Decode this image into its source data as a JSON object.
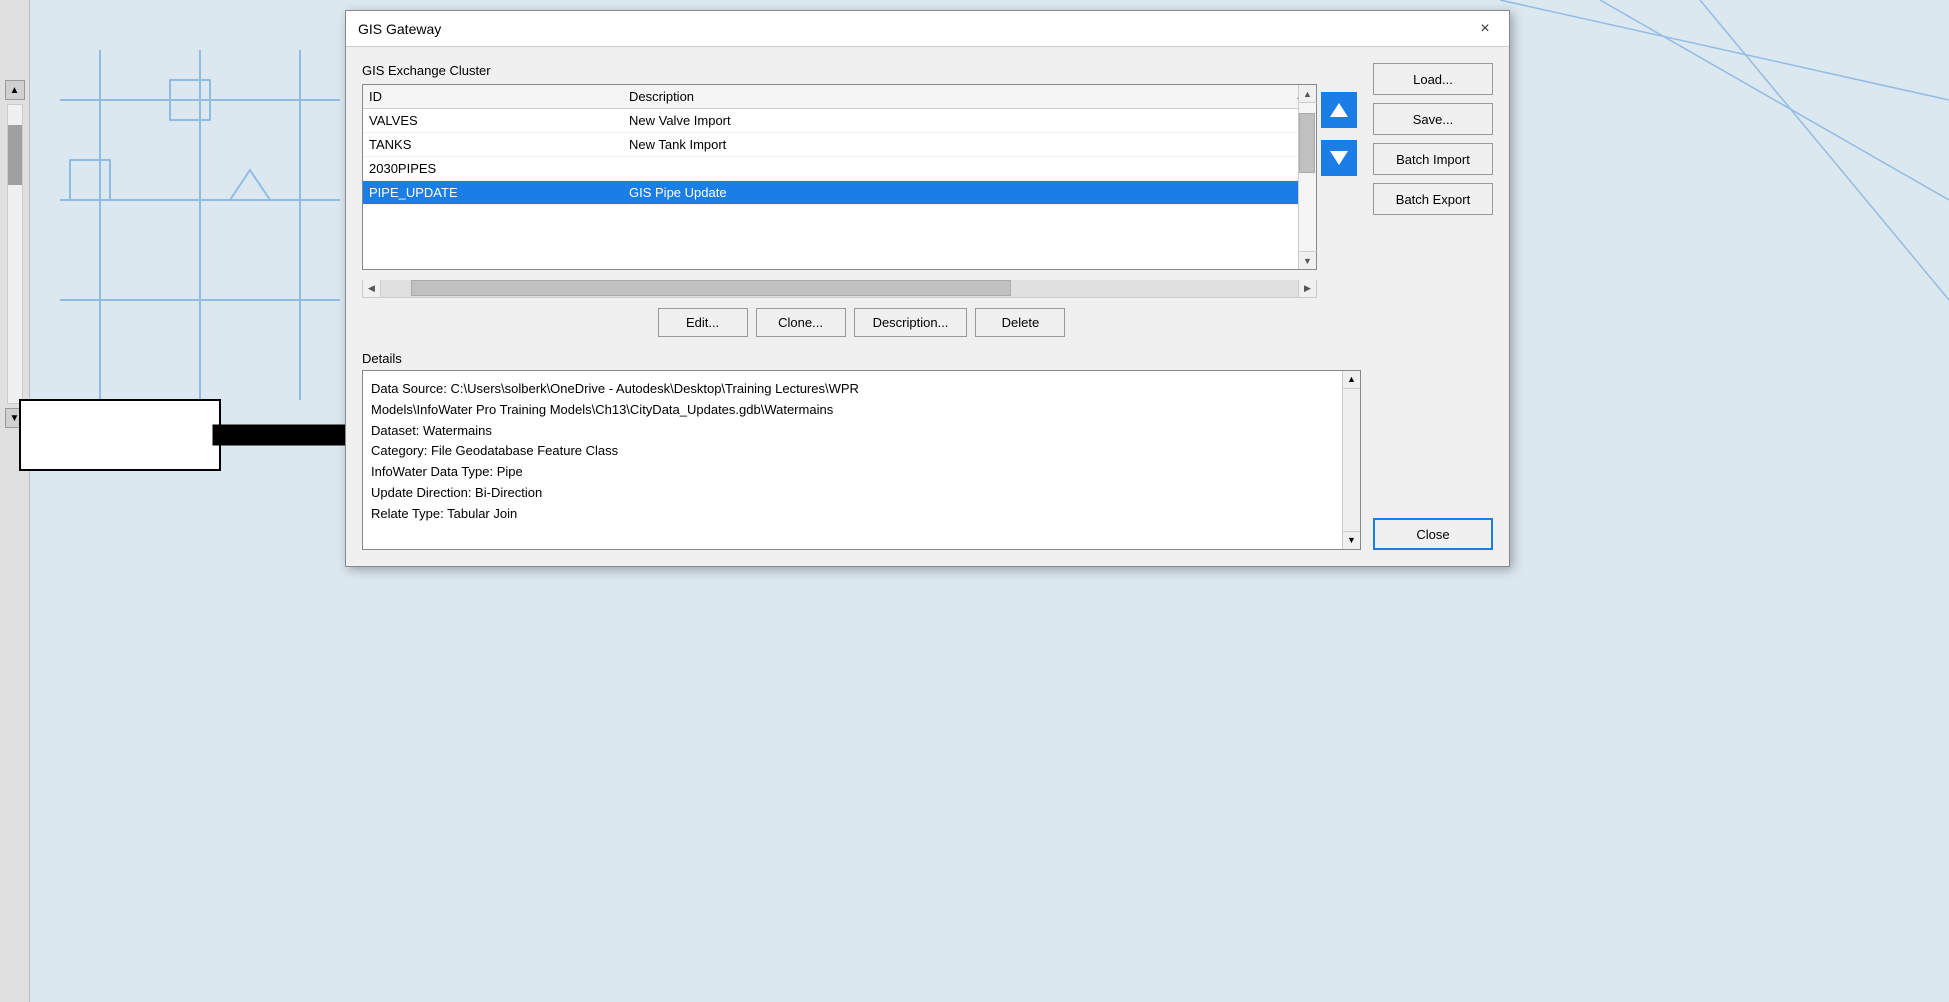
{
  "dialog": {
    "title": "GIS Gateway",
    "close_label": "×"
  },
  "exchange_cluster": {
    "label": "GIS Exchange Cluster",
    "columns": {
      "id": "ID",
      "description": "Description"
    },
    "rows": [
      {
        "id": "VALVES",
        "description": "New Valve Import",
        "selected": false
      },
      {
        "id": "TANKS",
        "description": "New Tank Import",
        "selected": false
      },
      {
        "id": "2030PIPES",
        "description": "",
        "selected": false
      },
      {
        "id": "PIPE_UPDATE",
        "description": "GIS Pipe Update",
        "selected": true
      }
    ]
  },
  "action_buttons": {
    "edit": "Edit...",
    "clone": "Clone...",
    "description": "Description...",
    "delete": "Delete"
  },
  "details": {
    "label": "Details",
    "text": "Data Source: C:\\Users\\solberk\\OneDrive - Autodesk\\Desktop\\Training Lectures\\WPR\nModels\\InfoWater Pro Training Models\\Ch13\\CityData_Updates.gdb\\Watermains\nDataset: Watermains\nCategory: File Geodatabase Feature Class\nInfoWater Data Type: Pipe\nUpdate Direction: Bi-Direction\nRelate Type: Tabular Join"
  },
  "sidebar_buttons": {
    "load": "Load...",
    "save": "Save...",
    "batch_import": "Batch Import",
    "batch_export": "Batch Export",
    "close": "Close"
  }
}
